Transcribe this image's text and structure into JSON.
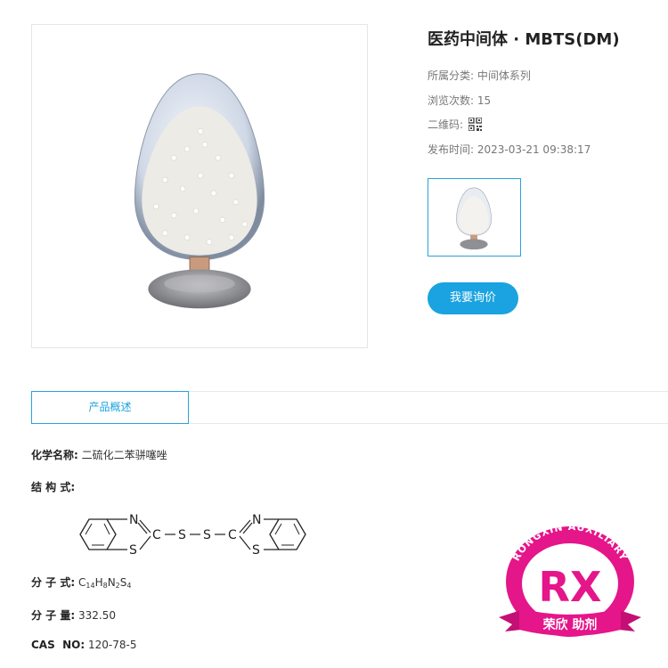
{
  "product": {
    "title": "医药中间体 · MBTS(DM)",
    "meta": [
      {
        "label": "所属分类:",
        "value": "中间体系列"
      },
      {
        "label": "浏览次数:",
        "value": "15"
      },
      {
        "label": "二维码:",
        "value": ""
      },
      {
        "label": "发布时间:",
        "value": "2023-03-21 09:38:17"
      }
    ],
    "inquire_label": "我要询价"
  },
  "tabs": [
    {
      "label": "产品概述"
    }
  ],
  "details": {
    "chemical_name_label": "化学名称",
    "chemical_name_value": "二硫化二苯骈噻唑",
    "structure_label": "结 构 式:",
    "formula_label": "分 子 式:",
    "formula_parts": [
      "C",
      "14",
      "H",
      "8",
      "N",
      "2",
      "S",
      "4"
    ],
    "mw_label": "分 子 量:",
    "mw_value": "332.50",
    "cas_label": "CAS  NO",
    "cas_value": "120-78-5"
  },
  "structure": {
    "atom_n": "N",
    "atom_s": "S",
    "atom_c": "C"
  },
  "logo": {
    "arc_text": "RONGXIN  AUXILIARY",
    "mark": "RX",
    "ribbon_text": "荣欣 助剂",
    "color": "#e5158a"
  },
  "colors": {
    "accent": "#1aa3e0",
    "tab_border": "#29a3da"
  },
  "icons": {
    "qr": "qr-code-icon"
  }
}
